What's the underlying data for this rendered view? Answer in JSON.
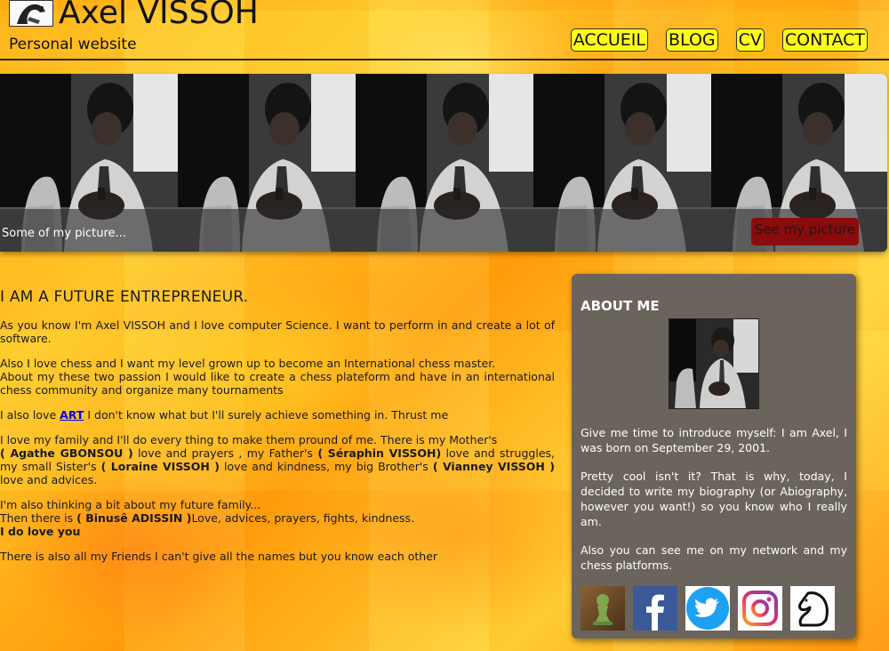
{
  "header": {
    "title": "Axel VISSOH",
    "subtitle": "Personal website",
    "nav": [
      "ACCUEIL",
      "BLOG",
      "CV",
      "CONTACT"
    ]
  },
  "banner": {
    "caption": "Some of my picture...",
    "button_label": "See my picture"
  },
  "main": {
    "heading": "I AM A FUTURE ENTREPRENEUR.",
    "p1": "As you know I'm Axel VISSOH and I love computer Science. I want to perform in and create a lot of software.",
    "p2a": "Also I love chess and I want my level grown up to become an International chess master.",
    "p2b": "About my these two passion I would like to create a chess plateform and have in an international chess community and organize many tournaments",
    "p3_before": "I also love ",
    "p3_link": "ART",
    "p3_after": " I don't know what but I'll surely achieve something in. Thrust me",
    "p4_1": "I love my family and I'll do every thing to make them pround of me. There is my Mother's",
    "p4_mother": "( Agathe GBONSOU )",
    "p4_2": " love and prayers , my Father's ",
    "p4_father": "( Séraphin VISSOH)",
    "p4_3": " love and struggles, my small Sister's ",
    "p4_sister": "( Loraine VISSOH )",
    "p4_4": " love and kindness, my big Brother's ",
    "p4_brother": "( Vianney VISSOH )",
    "p4_5": " love and advices.",
    "p5_1": "I'm also thinking a bit about my future family...",
    "p5_2": "Then there is ",
    "p5_name": "( Binusê ADISSIN )",
    "p5_3": "Love, advices, prayers, fights, kindness.",
    "p5_4": "I do love you",
    "p6": "There is also all my Friends I can't give all the names but you know each other"
  },
  "sidebar": {
    "title": "ABOUT ME",
    "p1": "Give me time to introduce myself: I am Axel, I was born on September 29, 2001.",
    "p2": "Pretty cool isn't it? That is why, today, I decided to write my biography (or Abiography, however you want!) so you know who I really am.",
    "p3": "Also you can see me on my network and my chess platforms."
  },
  "colors": {
    "nav_bg": "#ffff1a",
    "sidebar_bg": "#6b645d",
    "button_bg": "#8a0c0c",
    "link": "#0000ee"
  },
  "icons": [
    "chess-com-icon",
    "facebook-icon",
    "twitter-icon",
    "instagram-icon",
    "lichess-icon"
  ]
}
